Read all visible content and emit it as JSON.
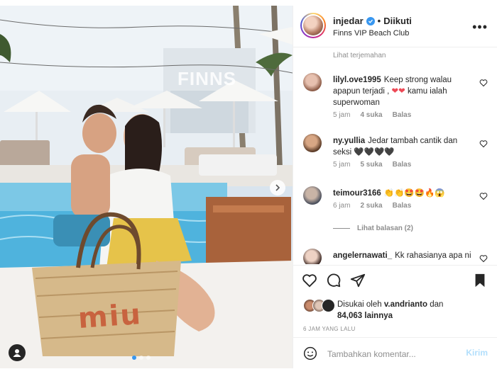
{
  "post": {
    "username": "injedar",
    "follow_status": "Diikuti",
    "location": "Finns VIP Beach Club",
    "watermark": "FINNS",
    "bag_text": "miu"
  },
  "see_translation": "Lihat terjemahan",
  "comments": [
    {
      "user": "lilyl.ove1995",
      "text": "Keep strong walau apapun terjadi ,",
      "text2": "kamu ialah superwoman",
      "emoji": "❤❤",
      "time": "5 jam",
      "likes": "4 suka",
      "reply": "Balas"
    },
    {
      "user": "ny.yullia",
      "text": "Jedar tambah cantik dan seksi",
      "emoji": "🖤🖤🖤🖤",
      "time": "5 jam",
      "likes": "5 suka",
      "reply": "Balas"
    },
    {
      "user": "teimour3166",
      "text": "",
      "emoji": "👏👏🤩🤩🔥😱",
      "time": "6 jam",
      "likes": "2 suka",
      "reply": "Balas"
    },
    {
      "user": "angelernawati_",
      "text": "Kk rahasianya apa ni",
      "emoji": "",
      "time": "",
      "likes": "",
      "reply": ""
    }
  ],
  "view_replies": "Lihat balasan (2)",
  "likes": {
    "prefix": "Disukai oleh",
    "liker": "v.andrianto",
    "conj": "dan",
    "count": "84,063",
    "suffix": "lainnya"
  },
  "timestamp": "6 JAM YANG LALU",
  "comment_box": {
    "placeholder": "Tambahkan komentar...",
    "post_label": "Kirim"
  },
  "colors": {
    "accent": "#3897f0",
    "post_disabled": "#b2dffc",
    "heart_red": "#ed4956",
    "muted": "#8e8e8e"
  },
  "icons": [
    "verified-badge-icon",
    "more-options-icon",
    "heart-icon",
    "comment-icon",
    "share-icon",
    "bookmark-icon",
    "emoji-icon",
    "user-tag-icon",
    "chevron-right-icon"
  ]
}
